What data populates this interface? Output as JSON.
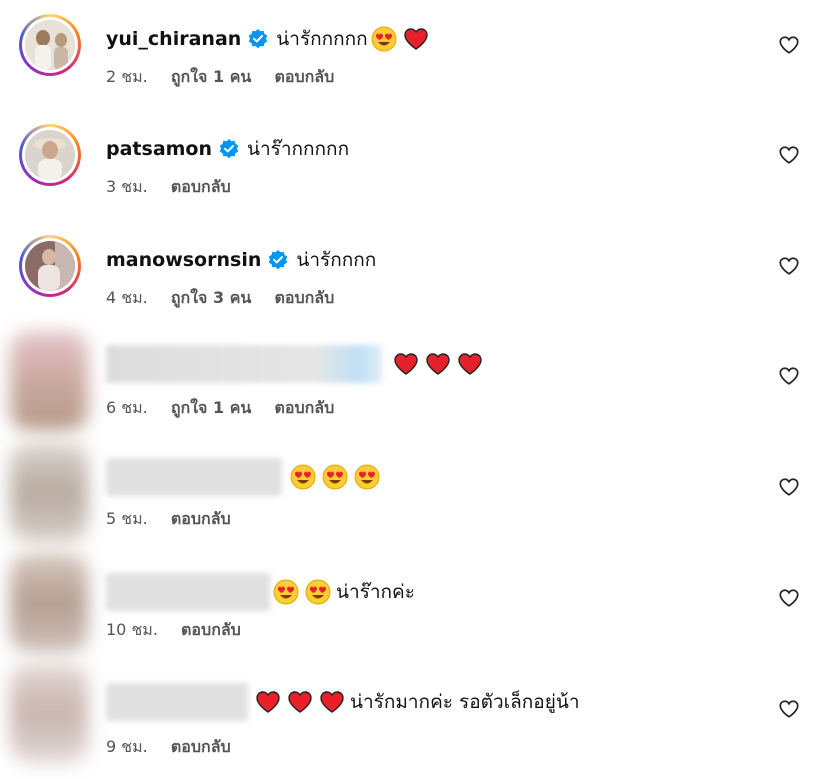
{
  "comments": [
    {
      "username": "yui_chiranan",
      "verified": true,
      "text": "น่ารักกกกก",
      "emojis": [
        "heart-eyes",
        "red-heart"
      ],
      "time": "2 ชม.",
      "likes": "ถูกใจ 1 คน",
      "reply": "ตอบกลับ"
    },
    {
      "username": "patsamon",
      "verified": true,
      "text": "น่าร๊ากกกกก",
      "emojis": [],
      "time": "3 ชม.",
      "likes": "",
      "reply": "ตอบกลับ"
    },
    {
      "username": "manowsornsin",
      "verified": true,
      "text": "น่ารักกกก",
      "emojis": [],
      "time": "4 ชม.",
      "likes": "ถูกใจ 3 คน",
      "reply": "ตอบกลับ"
    },
    {
      "username": "",
      "verified": false,
      "text": "",
      "emojis": [
        "red-heart",
        "red-heart",
        "red-heart"
      ],
      "time": "6 ชม.",
      "likes": "ถูกใจ 1 คน",
      "reply": "ตอบกลับ"
    },
    {
      "username": "",
      "verified": false,
      "text": "",
      "emojis": [
        "heart-eyes",
        "heart-eyes",
        "heart-eyes"
      ],
      "time": "5 ชม.",
      "likes": "",
      "reply": "ตอบกลับ"
    },
    {
      "username": "",
      "verified": false,
      "text": "น่าร๊ากค่ะ",
      "emojis": [
        "heart-eyes",
        "heart-eyes"
      ],
      "time": "10 ชม.",
      "likes": "",
      "reply": "ตอบกลับ"
    },
    {
      "username": "",
      "verified": false,
      "text": "น่ารักมากค่ะ รอตัวเล็กอยู่น้า",
      "emojis": [
        "red-heart",
        "red-heart",
        "red-heart"
      ],
      "time": "9 ชม.",
      "likes": "",
      "reply": "ตอบกลับ"
    }
  ],
  "colors": {
    "verified_blue": "#0095f6",
    "heart_red": "#ed1c24",
    "meta_gray": "#737373"
  }
}
